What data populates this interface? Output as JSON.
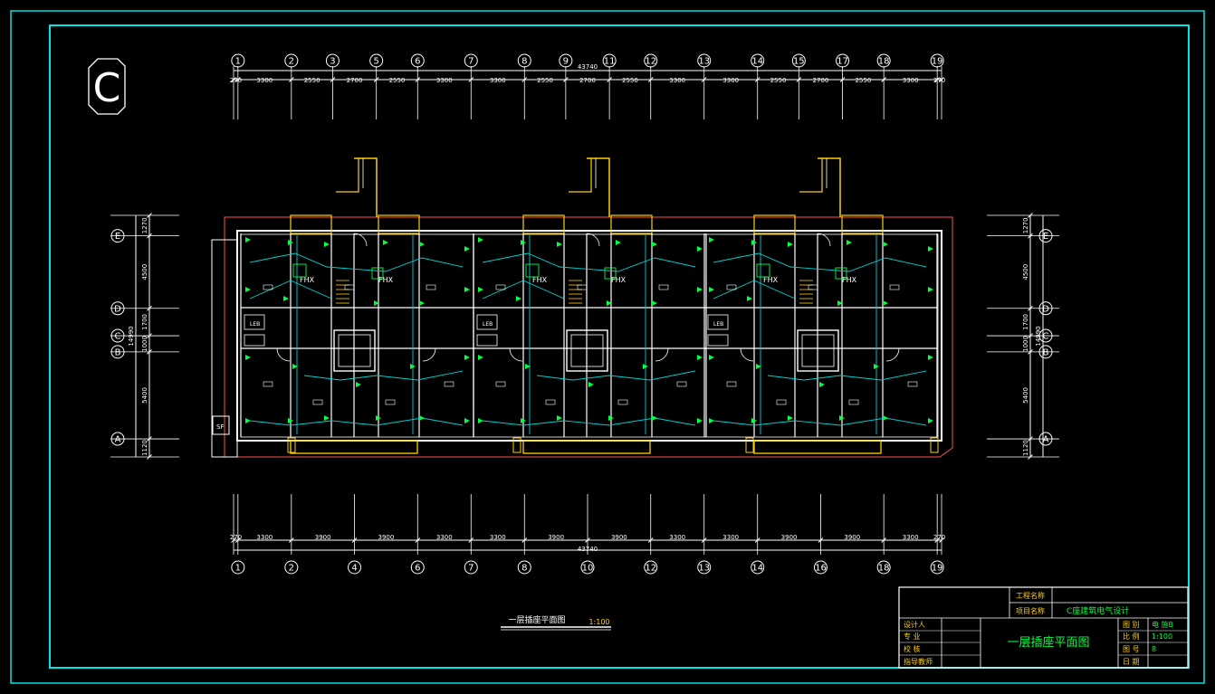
{
  "sheet": {
    "block_letter": "C",
    "colors": {
      "border": "#00e5e5",
      "lines": "#ffffff",
      "wiring": "#00d0d0",
      "sockets": "#00ff40",
      "walls_accent": "#ffd000",
      "outline": "#ff5050",
      "title_text": "#00ff40",
      "label_text": "#ffd000"
    }
  },
  "top_axes": [
    "1",
    "2",
    "3",
    "5",
    "6",
    "7",
    "8",
    "9",
    "11",
    "12",
    "13",
    "14",
    "15",
    "17",
    "18",
    "19"
  ],
  "top_dims": [
    "270",
    "3300",
    "2550",
    "2700",
    "2550",
    "3300",
    "3300",
    "2550",
    "2700",
    "2550",
    "3300",
    "3300",
    "2550",
    "2700",
    "2550",
    "3300",
    "270"
  ],
  "top_total": "43740",
  "bottom_axes": [
    "1",
    "2",
    "4",
    "6",
    "7",
    "8",
    "10",
    "12",
    "13",
    "14",
    "16",
    "18",
    "19"
  ],
  "bottom_dims": [
    "270",
    "3300",
    "3900",
    "3900",
    "3300",
    "3300",
    "3900",
    "3900",
    "3300",
    "3300",
    "3900",
    "3900",
    "3300",
    "270"
  ],
  "bottom_total": "43740",
  "left_axes": [
    "E",
    "D",
    "C",
    "B",
    "A"
  ],
  "left_dims": [
    "1270",
    "4500",
    "1700",
    "1000",
    "5400",
    "1120"
  ],
  "left_total": "14990",
  "right_axes": [
    "E",
    "D",
    "C",
    "B",
    "A"
  ],
  "right_dims": [
    "1270",
    "4500",
    "1700",
    "1000",
    "5400",
    "1120"
  ],
  "right_total": "14990",
  "plan_labels": {
    "fhx": "FHX",
    "leb": "LEB",
    "sf": "SF"
  },
  "plan_caption": {
    "name": "一层插座平面图",
    "scale": "1:100"
  },
  "title_block": {
    "project_name_label": "工程名称",
    "project_name_value": "",
    "item_name_label": "项目名称",
    "item_name_value": "C座建筑电气设计",
    "drawing_title": "一层插座平面图",
    "roles": [
      "设计人",
      "专 业",
      "校 核",
      "指导教师"
    ],
    "fields": [
      {
        "label": "图 别",
        "value": "电 施B"
      },
      {
        "label": "比 例",
        "value": "1:100"
      },
      {
        "label": "图 号",
        "value": "8"
      },
      {
        "label": "日 期",
        "value": ""
      }
    ]
  }
}
